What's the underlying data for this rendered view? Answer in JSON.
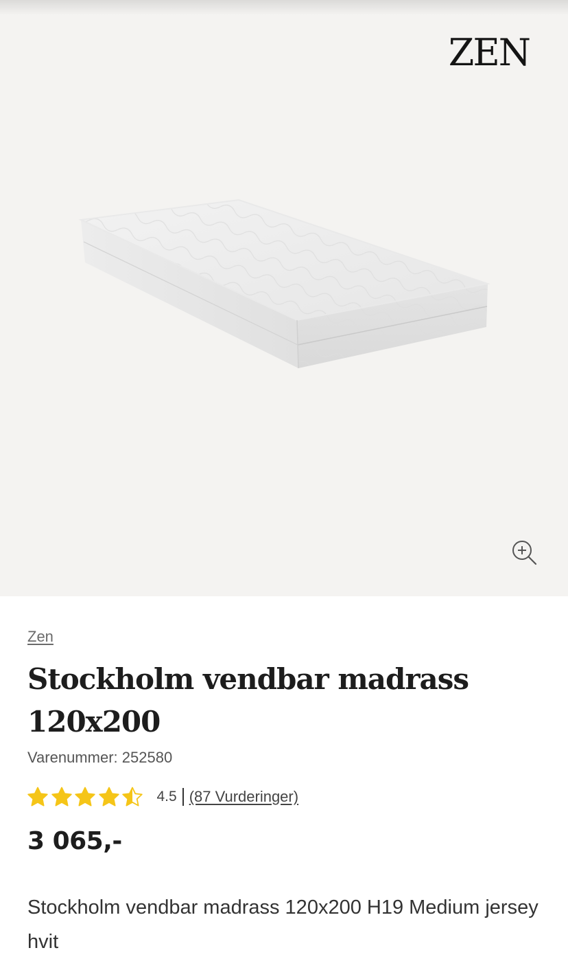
{
  "header": {
    "logo_text": "ZEN"
  },
  "gallery": {
    "background_color": "#f4f3f1",
    "image_alt": "Stockholm vendbar madrass 120x200",
    "zoom_icon": "zoom-in-icon"
  },
  "product": {
    "brand": "Zen",
    "title": "Stockholm vendbar madrass 120x200",
    "sku_label": "Varenummer:",
    "sku_value": "252580",
    "rating": {
      "value": 4.5,
      "value_text": "4.5",
      "max": 5,
      "reviews_text": "(87 Vurderinger)",
      "star_color": "#f5c518"
    },
    "price": "3 065,-",
    "description": "Stockholm vendbar madrass 120x200 H19 Medium jersey hvit"
  }
}
